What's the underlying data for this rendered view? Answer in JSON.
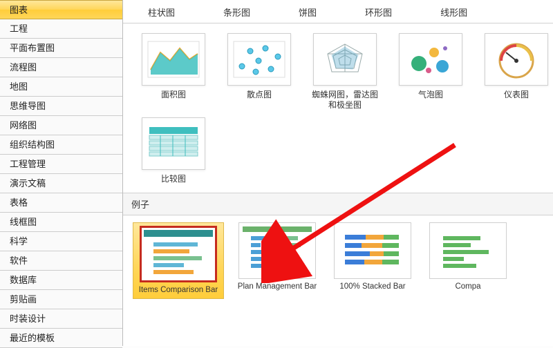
{
  "sidebar": {
    "items": [
      {
        "label": "图表",
        "selected": true
      },
      {
        "label": "工程"
      },
      {
        "label": "平面布置图"
      },
      {
        "label": "流程图"
      },
      {
        "label": "地图"
      },
      {
        "label": "思维导图"
      },
      {
        "label": "网络图"
      },
      {
        "label": "组织结构图"
      },
      {
        "label": "工程管理"
      },
      {
        "label": "演示文稿"
      },
      {
        "label": "表格"
      },
      {
        "label": "线框图"
      },
      {
        "label": "科学"
      },
      {
        "label": "软件"
      },
      {
        "label": "数据库"
      },
      {
        "label": "剪贴画"
      },
      {
        "label": "时装设计"
      },
      {
        "label": "最近的模板"
      }
    ]
  },
  "chart_type_tabs": [
    "柱状图",
    "条形图",
    "饼图",
    "环形图",
    "线形图"
  ],
  "chart_thumbs": [
    {
      "name": "area-chart",
      "label": "面积图"
    },
    {
      "name": "scatter-chart",
      "label": "散点图"
    },
    {
      "name": "radar-chart",
      "label": "蜘蛛网图，雷达图和极坐图"
    },
    {
      "name": "bubble-chart",
      "label": "气泡图"
    },
    {
      "name": "gauge-chart",
      "label": "仪表图"
    },
    {
      "name": "compare-chart",
      "label": "比较图"
    }
  ],
  "examples_header": "例子",
  "examples": [
    {
      "name": "items-comparison-bar",
      "label": "Items Comparison Bar",
      "selected": true
    },
    {
      "name": "plan-management-bar",
      "label": "Plan Management Bar"
    },
    {
      "name": "100-stacked-bar",
      "label": "100% Stacked Bar"
    },
    {
      "name": "comp",
      "label": "Compa"
    }
  ]
}
